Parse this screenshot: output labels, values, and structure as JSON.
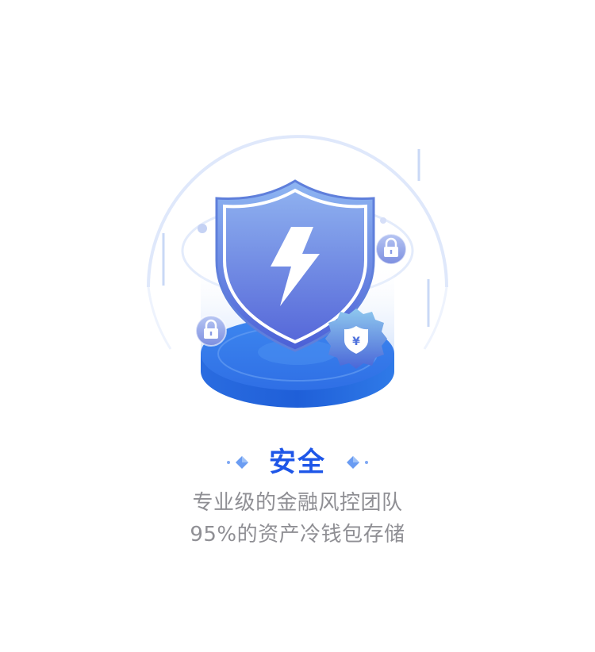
{
  "feature": {
    "title": "安全",
    "description_line1": "专业级的金融风控团队",
    "description_line2": "95%的资产冷钱包存储"
  },
  "icons": {
    "hero": "security-shield-icon",
    "bolt": "lightning-bolt-icon",
    "lock": "padlock-icon",
    "yuan_badge": "yuan-shield-badge-icon"
  },
  "colors": {
    "accent": "#1e56e8",
    "description_text": "#8f8f94",
    "shield_top": "#8fb6f2",
    "shield_bottom": "#4a5fd6",
    "platform": "#2d6fe3"
  }
}
